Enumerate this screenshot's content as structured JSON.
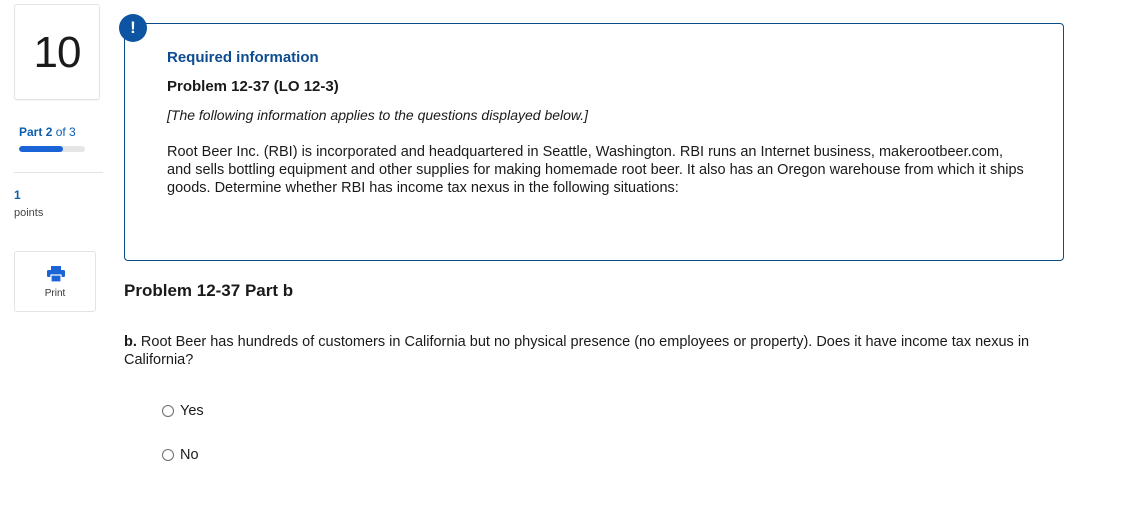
{
  "sidebar": {
    "question_number": "10",
    "part_prefix": "Part",
    "part_current": "2",
    "part_suffix": "of 3",
    "progress_fraction": 0.67,
    "points_value": "1",
    "points_label": "points",
    "print_label": "Print"
  },
  "required_info": {
    "alert_symbol": "!",
    "heading": "Required information",
    "problem_title": "Problem 12-37 (LO 12-3)",
    "note": "[The following information applies to the questions displayed below.]",
    "body": "Root Beer Inc. (RBI) is incorporated and headquartered in Seattle, Washington. RBI runs an Internet business, makerootbeer.com, and sells bottling equipment and other supplies for making homemade root beer. It also has an Oregon warehouse from which it ships goods. Determine whether RBI has income tax nexus in the following situations:"
  },
  "part_b": {
    "heading": "Problem 12-37 Part b",
    "question_lead": "b.",
    "question_text": "Root Beer has hundreds of customers in California but no physical presence (no employees or property). Does it have income tax nexus in California?",
    "options": [
      "Yes",
      "No"
    ]
  },
  "colors": {
    "accent": "#0d55a3",
    "progress": "#1b64d6",
    "box_border": "#0b4d8a"
  },
  "icons": {
    "print": "printer-icon",
    "alert": "exclamation-icon"
  }
}
